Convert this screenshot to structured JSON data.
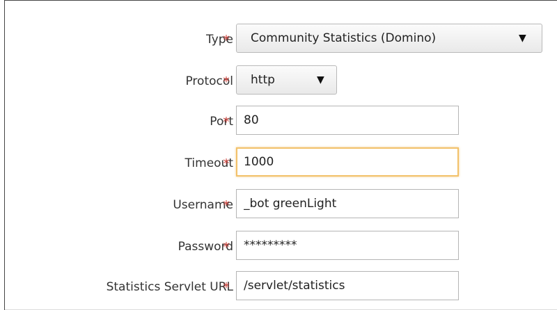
{
  "form": {
    "type": {
      "label": "Type",
      "value": "Community Statistics (Domino)",
      "caret": "▼"
    },
    "protocol": {
      "label": "Protocol",
      "value": "http",
      "caret": "▼"
    },
    "port": {
      "label": "Port",
      "value": "80"
    },
    "timeout": {
      "label": "Timeout",
      "value": "1000"
    },
    "username": {
      "label": "Username",
      "value": "_bot greenLight"
    },
    "password": {
      "label": "Password",
      "value": "*********"
    },
    "servlet_url": {
      "label": "Statistics Servlet URL",
      "value": "/servlet/statistics"
    },
    "required_marker": "*"
  },
  "colors": {
    "required": "#d0443e",
    "focus_border": "#f2c16a",
    "label": "#333333"
  }
}
